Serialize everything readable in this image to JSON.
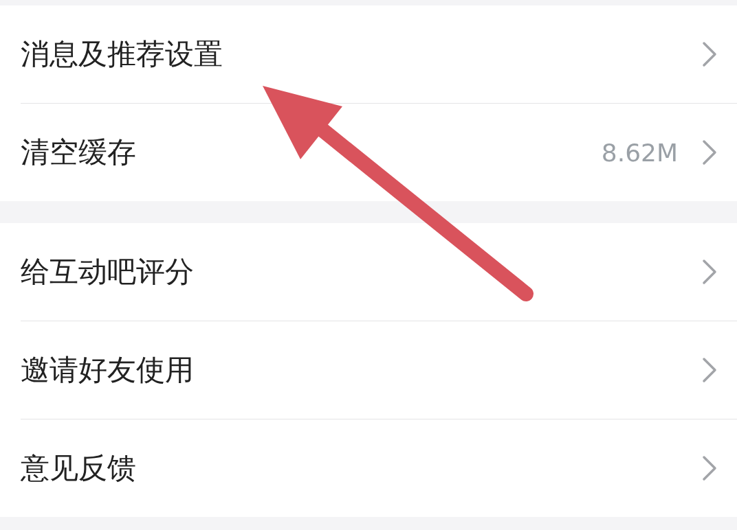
{
  "groups": [
    {
      "items": [
        {
          "label": "消息及推荐设置"
        },
        {
          "label": "清空缓存",
          "value": "8.62M"
        }
      ]
    },
    {
      "items": [
        {
          "label": "给互动吧评分"
        },
        {
          "label": "邀请好友使用"
        },
        {
          "label": "意见反馈"
        }
      ]
    }
  ]
}
